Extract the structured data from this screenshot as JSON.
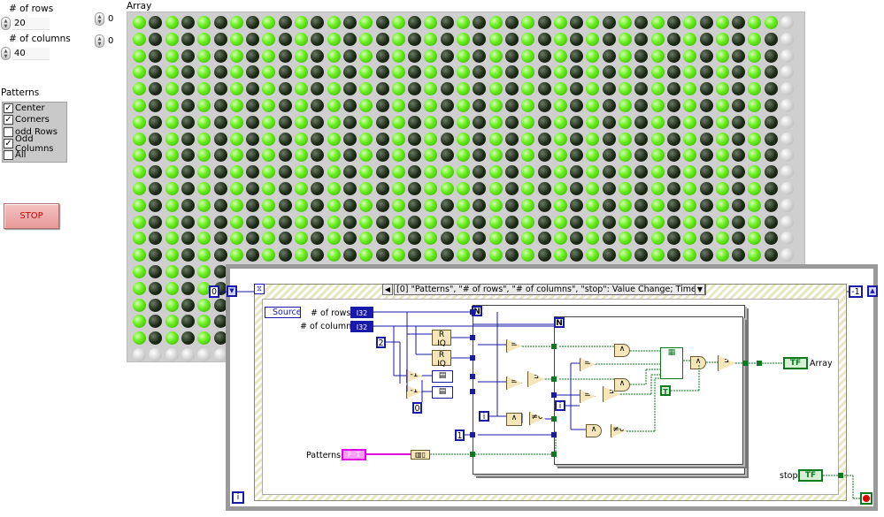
{
  "controls": {
    "rows_label": "# of rows",
    "rows_value": "20",
    "columns_label": "# of columns",
    "columns_value": "40",
    "index0_value": "0",
    "index1_value": "0"
  },
  "array": {
    "label": "Array",
    "visible_rows": 20,
    "visible_columns": 40,
    "on_color": "#5ce61a",
    "off_color": "#1c2a15"
  },
  "patterns": {
    "label": "Patterns",
    "items": [
      {
        "label": "Center",
        "checked": true,
        "mark": "✓"
      },
      {
        "label": "Corners",
        "checked": true,
        "mark": "✓"
      },
      {
        "label": "odd Rows",
        "checked": false,
        "mark": ""
      },
      {
        "label": "Odd Columns",
        "checked": true,
        "mark": "✓"
      },
      {
        "label": "All",
        "checked": false,
        "mark": ""
      }
    ]
  },
  "stop_button": {
    "label": "STOP"
  },
  "block_diagram": {
    "case_selector": "[0] \"Patterns\", \"# of rows\", \"# of columns\", \"stop\": Value Change;  Timeout",
    "left_const": "0",
    "right_const": "-1",
    "source_label": "Source",
    "rows_term_label": "# of rows",
    "columns_term_label": "# of columns",
    "i32": "I32",
    "n_label": "N",
    "i_label": "i",
    "const_2": "2",
    "const_0": "0",
    "const_1": "1",
    "patterns_term_label": "Patterns",
    "array_term_label": "Array",
    "tf": "TF",
    "stop_term_label": "stop",
    "t_const": "T"
  }
}
